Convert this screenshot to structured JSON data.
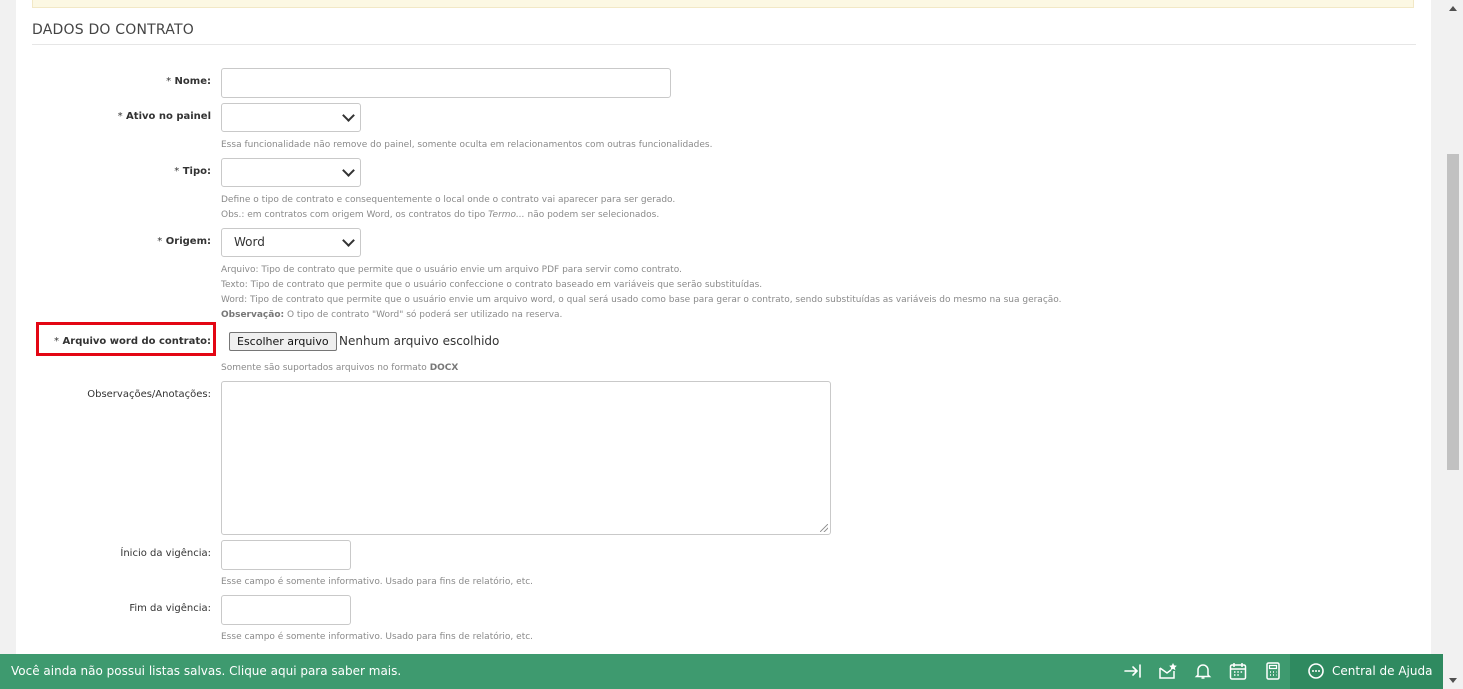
{
  "section": {
    "title": "DADOS DO CONTRATO"
  },
  "form": {
    "required_mark": "*",
    "nome": {
      "label": "Nome:",
      "value": ""
    },
    "ativo": {
      "label": "Ativo no painel",
      "value": "",
      "help": "Essa funcionalidade não remove do painel, somente oculta em relacionamentos com outras funcionalidades."
    },
    "tipo": {
      "label": "Tipo:",
      "value": "",
      "help_1": "Define o tipo de contrato e consequentemente o local onde o contrato vai aparecer para ser gerado.",
      "help_2_prefix": "Obs.: em contratos com origem Word, os contratos do tipo ",
      "help_2_em": "Termo...",
      "help_2_suffix": " não podem ser selecionados."
    },
    "origem": {
      "label": "Origem:",
      "value": "Word",
      "help_1": "Arquivo: Tipo de contrato que permite que o usuário envie um arquivo PDF para servir como contrato.",
      "help_2": "Texto: Tipo de contrato que permite que o usuário confeccione o contrato baseado em variáveis que serão substituídas.",
      "help_3": "Word: Tipo de contrato que permite que o usuário envie um arquivo word, o qual será usado como base para gerar o contrato, sendo substituídas as variáveis do mesmo na sua geração.",
      "help_4_bold": "Observação:",
      "help_4_text": " O tipo de contrato \"Word\" só poderá ser utilizado na reserva."
    },
    "arquivo": {
      "label": "Arquivo word do contrato:",
      "button": "Escolher arquivo",
      "status": "Nenhum arquivo escolhido",
      "help_prefix": "Somente são suportados arquivos no formato ",
      "help_bold": "DOCX"
    },
    "observacoes": {
      "label": "Observações/Anotações:",
      "value": ""
    },
    "inicio": {
      "label": "Ínicio da vigência:",
      "value": "",
      "help": "Esse campo é somente informativo. Usado para fins de relatório, etc."
    },
    "fim": {
      "label": "Fim da vigência:",
      "value": "",
      "help": "Esse campo é somente informativo. Usado para fins de relatório, etc."
    }
  },
  "bottom_bar": {
    "message": "Você ainda não possui listas salvas. Clique aqui para saber mais.",
    "help_label": "Central de Ajuda",
    "icons": [
      "collapse-right-icon",
      "mail-star-icon",
      "bell-icon",
      "calendar-icon",
      "calculator-icon",
      "chat-help-icon"
    ]
  },
  "colors": {
    "bar_green": "#3e9a6f",
    "help_green": "#2f8a60",
    "highlight_red": "#e30613"
  }
}
